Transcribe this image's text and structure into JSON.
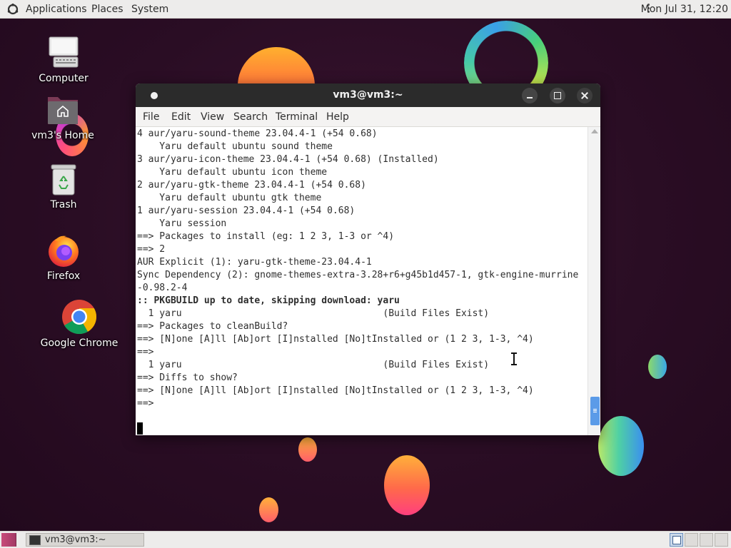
{
  "top_panel": {
    "menus": [
      "Applications",
      "Places",
      "System"
    ],
    "clock": "Mon Jul 31, 12:20"
  },
  "desktop": {
    "icons": [
      {
        "label": "Computer",
        "icon": "computer-icon"
      },
      {
        "label": "vm3's Home",
        "icon": "home-folder-icon"
      },
      {
        "label": "Trash",
        "icon": "trash-icon"
      },
      {
        "label": "Firefox",
        "icon": "firefox-icon"
      },
      {
        "label": "Google Chrome",
        "icon": "chrome-icon"
      }
    ]
  },
  "terminal": {
    "title": "vm3@vm3:~",
    "menus": [
      "File",
      "Edit",
      "View",
      "Search",
      "Terminal",
      "Help"
    ],
    "lines": [
      {
        "text": "4 aur/yaru-sound-theme 23.04.4-1 (+54 0.68)",
        "bold": false
      },
      {
        "text": "    Yaru default ubuntu sound theme",
        "bold": false
      },
      {
        "text": "3 aur/yaru-icon-theme 23.04.4-1 (+54 0.68) (Installed)",
        "bold": false
      },
      {
        "text": "    Yaru default ubuntu icon theme",
        "bold": false
      },
      {
        "text": "2 aur/yaru-gtk-theme 23.04.4-1 (+54 0.68)",
        "bold": false
      },
      {
        "text": "    Yaru default ubuntu gtk theme",
        "bold": false
      },
      {
        "text": "1 aur/yaru-session 23.04.4-1 (+54 0.68)",
        "bold": false
      },
      {
        "text": "    Yaru session",
        "bold": false
      },
      {
        "text": "==> Packages to install (eg: 1 2 3, 1-3 or ^4)",
        "bold": false
      },
      {
        "text": "==> 2",
        "bold": false
      },
      {
        "text": "AUR Explicit (1): yaru-gtk-theme-23.04.4-1",
        "bold": false
      },
      {
        "text": "Sync Dependency (2): gnome-themes-extra-3.28+r6+g45b1d457-1, gtk-engine-murrine",
        "bold": false
      },
      {
        "text": "-0.98.2-4",
        "bold": false
      },
      {
        "text": ":: PKGBUILD up to date, skipping download: yaru",
        "bold": true
      },
      {
        "text": "  1 yaru                                    (Build Files Exist)",
        "bold": false
      },
      {
        "text": "==> Packages to cleanBuild?",
        "bold": false
      },
      {
        "text": "==> [N]one [A]ll [Ab]ort [I]nstalled [No]tInstalled or (1 2 3, 1-3, ^4)",
        "bold": false
      },
      {
        "text": "==>",
        "bold": false
      },
      {
        "text": "  1 yaru                                    (Build Files Exist)",
        "bold": false
      },
      {
        "text": "==> Diffs to show?",
        "bold": false
      },
      {
        "text": "==> [N]one [A]ll [Ab]ort [I]nstalled [No]tInstalled or (1 2 3, 1-3, ^4)",
        "bold": false
      },
      {
        "text": "==>",
        "bold": false
      }
    ]
  },
  "bottom_panel": {
    "task_label": "vm3@vm3:~",
    "workspaces": [
      "1",
      "2",
      "3",
      "4"
    ],
    "active_workspace": 1
  }
}
